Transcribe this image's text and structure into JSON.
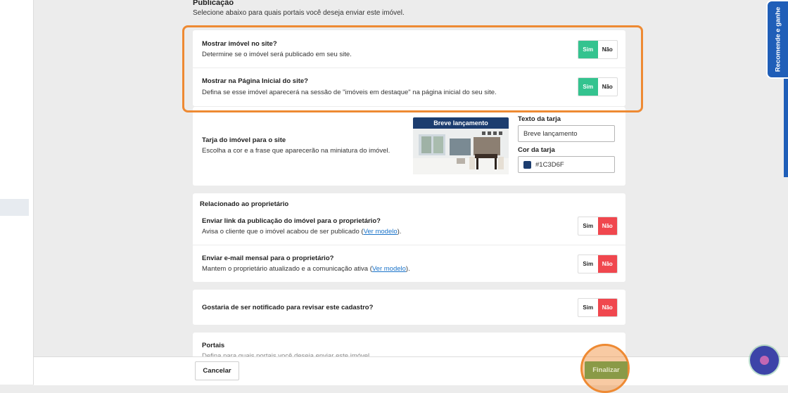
{
  "publicacao": {
    "title": "Publicação",
    "subtitle": "Selecione abaixo para quais portais você deseja enviar este imóvel."
  },
  "site_settings": {
    "rows": [
      {
        "title": "Mostrar imóvel no site?",
        "desc": "Determine se o imóvel será publicado em seu site.",
        "yes": "Sim",
        "no": "Não",
        "selected": "Sim"
      },
      {
        "title": "Mostrar na Página Inicial do site?",
        "desc": "Defina se esse imóvel aparecerá na sessão de \"imóveis em destaque\" na página inicial do seu site.",
        "yes": "Sim",
        "no": "Não",
        "selected": "Sim"
      }
    ]
  },
  "tarja": {
    "title": "Tarja do imóvel para o site",
    "desc": "Escolha a cor e a frase que aparecerão na miniatura do imóvel.",
    "preview_text": "Breve lançamento",
    "text_label": "Texto da tarja",
    "text_value": "Breve lançamento",
    "color_label": "Cor da tarja",
    "color_value": "#1C3D6F"
  },
  "proprietario": {
    "heading": "Relacionado ao proprietário",
    "rows": [
      {
        "title": "Enviar link da publicação do imóvel para o proprietário?",
        "desc_before": "Avisa o cliente que o imóvel acabou de ser publicado (",
        "link": "Ver modelo",
        "desc_after": ").",
        "yes": "Sim",
        "no": "Não",
        "selected": "Não"
      },
      {
        "title": "Enviar e-mail mensal para o proprietário?",
        "desc_before": "Mantem o proprietário atualizado e a comunicação ativa (",
        "link": "Ver modelo",
        "desc_after": ").",
        "yes": "Sim",
        "no": "Não",
        "selected": "Não"
      }
    ]
  },
  "revisao": {
    "title": "Gostaria de ser notificado para revisar este cadastro?",
    "yes": "Sim",
    "no": "Não",
    "selected": "Não"
  },
  "portais": {
    "title": "Portais",
    "desc": "Defina para quais portais você deseja enviar este imóvel."
  },
  "footer": {
    "cancel_label": "Cancelar",
    "finish_label": "Finalizar"
  },
  "side_tab": {
    "label": "Recomende e ganhe"
  },
  "icons": {
    "chat": "chat-bubble-icon",
    "color_swatch": "color-swatch-icon"
  },
  "colors": {
    "accent_green": "#34c38f",
    "accent_red": "#f0474e",
    "highlight_orange": "#ee8a33",
    "brand_blue": "#1f5eb8",
    "tarja_color": "#1C3D6F"
  }
}
